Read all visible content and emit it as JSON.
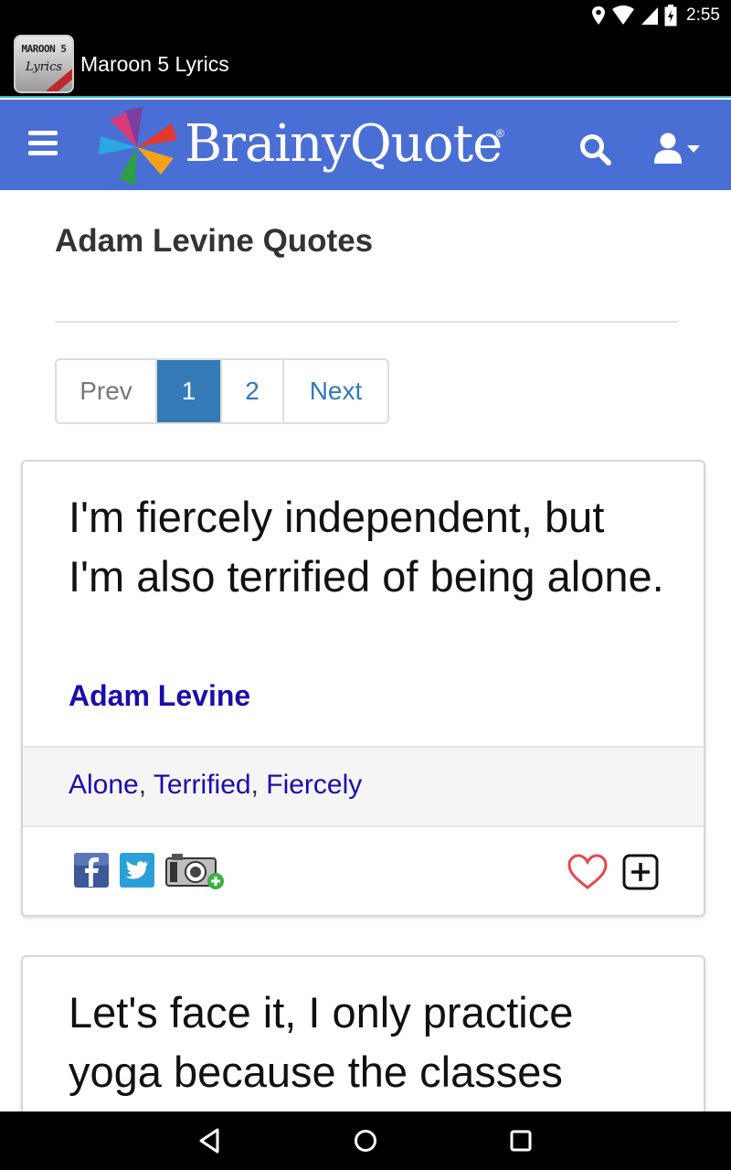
{
  "status_bar": {
    "time": "2:55",
    "icons": [
      "location-icon",
      "wifi-icon",
      "signal-icon",
      "battery-icon"
    ]
  },
  "app_bar": {
    "icon_line1": "MAROON 5",
    "icon_line2": "Lyrics",
    "title": "Maroon 5 Lyrics"
  },
  "header": {
    "logo_text": "BrainyQuote",
    "logo_registered": "®",
    "background_color": "#4a6fd4",
    "icons": [
      "menu-icon",
      "search-icon",
      "user-icon"
    ]
  },
  "page": {
    "title": "Adam Levine Quotes"
  },
  "pagination": {
    "prev": "Prev",
    "pages": [
      "1",
      "2"
    ],
    "current": "1",
    "next": "Next",
    "active_color": "#337ab7"
  },
  "quotes": [
    {
      "text": "I'm fiercely independent, but I'm also terrified of being alone.",
      "author": "Adam Levine",
      "tags": [
        "Alone",
        "Terrified",
        "Fiercely"
      ]
    },
    {
      "text": "Let's face it, I only practice yoga because the classes"
    }
  ],
  "share_icons": [
    "facebook-icon",
    "twitter-icon",
    "camera-add-icon"
  ],
  "action_icons": [
    "heart-icon",
    "plus-box-icon"
  ],
  "nav_bar": {
    "icons": [
      "back-icon",
      "home-icon",
      "recents-icon"
    ]
  }
}
